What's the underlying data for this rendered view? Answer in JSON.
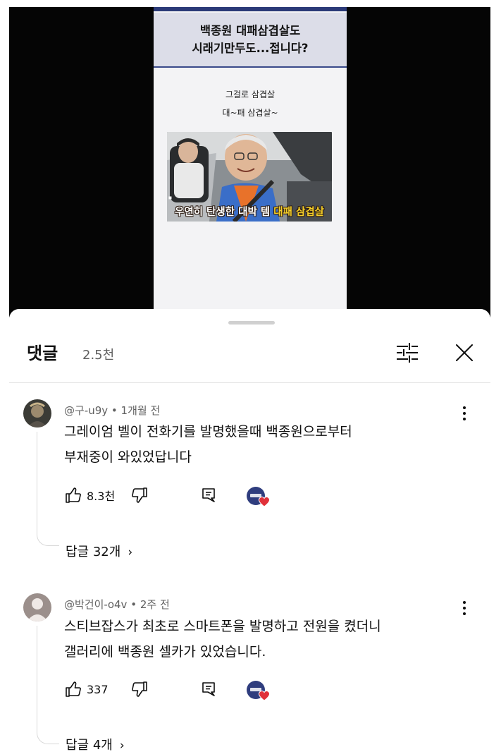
{
  "video": {
    "title_line1": "백종원 대패삼겹살도",
    "title_line2": "시래기만두도...접니다?",
    "caption_line1": "그걸로 삼겹살",
    "caption_line2": "대~패 삼겹살~",
    "thumbnail": {
      "caption_before": "우연히 탄생한 대박 템 ",
      "caption_highlight": "대패 삼겹살",
      "highlight_color": "#f5cf2a"
    }
  },
  "sheet": {
    "title": "댓글",
    "count": "2.5천",
    "filter_icon": "sliders-icon",
    "close_icon": "close-icon"
  },
  "comments": [
    {
      "author": "@구-u9y",
      "time": "1개월 전",
      "line1": "그레이엄 벨이 전화기를 발명했을때 백종원으로부터",
      "line2": "부재중이 와있었답니다",
      "likes": "8.3천",
      "replies": "답글 32개"
    },
    {
      "author": "@박건이-o4v",
      "time": "2주 전",
      "line1": "스티브잡스가 최초로 스마트폰을 발명하고 전원을 켰더니",
      "line2": "갤러리에 백종원 셀카가 있었습니다.",
      "likes": "337",
      "replies": "답글 4개"
    }
  ],
  "colors": {
    "creator_badge": "#2f3d7e",
    "heart": "#e0313a",
    "secondary_text": "#606060"
  }
}
